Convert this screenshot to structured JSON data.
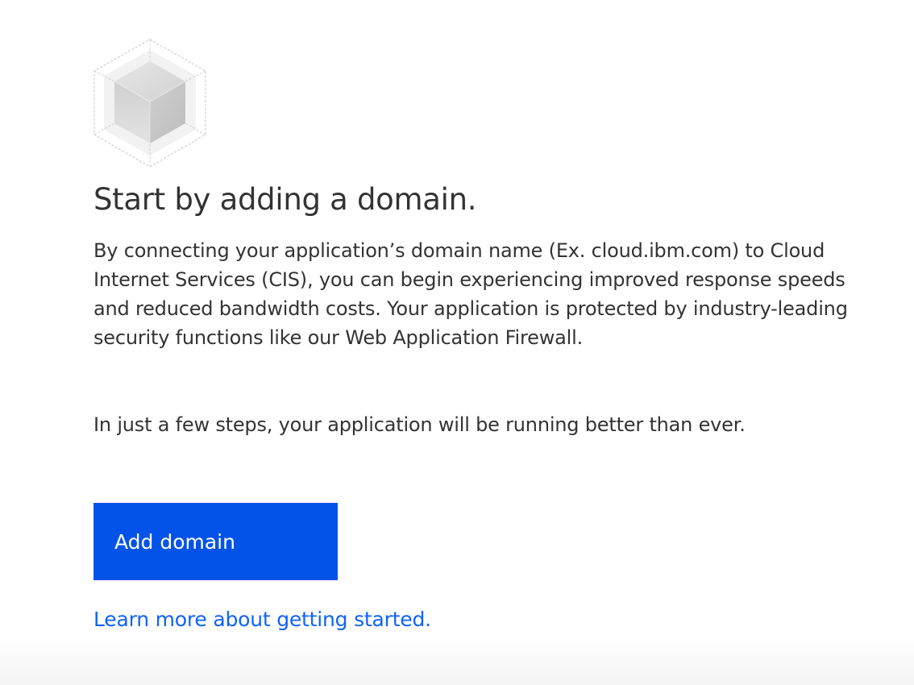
{
  "empty_state": {
    "illustration": "cube-illustration-icon",
    "heading": "Start by adding a domain.",
    "description": "By connecting your application’s domain name (Ex. cloud.ibm.com) to Cloud Internet Services (CIS), you can begin experiencing improved response speeds and reduced bandwidth costs. Your application is protected by industry-leading security functions like our Web Application Firewall.",
    "description_secondary": "In just a few steps, your application will be running better than ever.",
    "primary_button_label": "Add domain",
    "learn_more_link": "Learn more about getting started."
  },
  "colors": {
    "primary_button": "#0353e9",
    "link": "#0f62fe",
    "text": "#333333"
  }
}
